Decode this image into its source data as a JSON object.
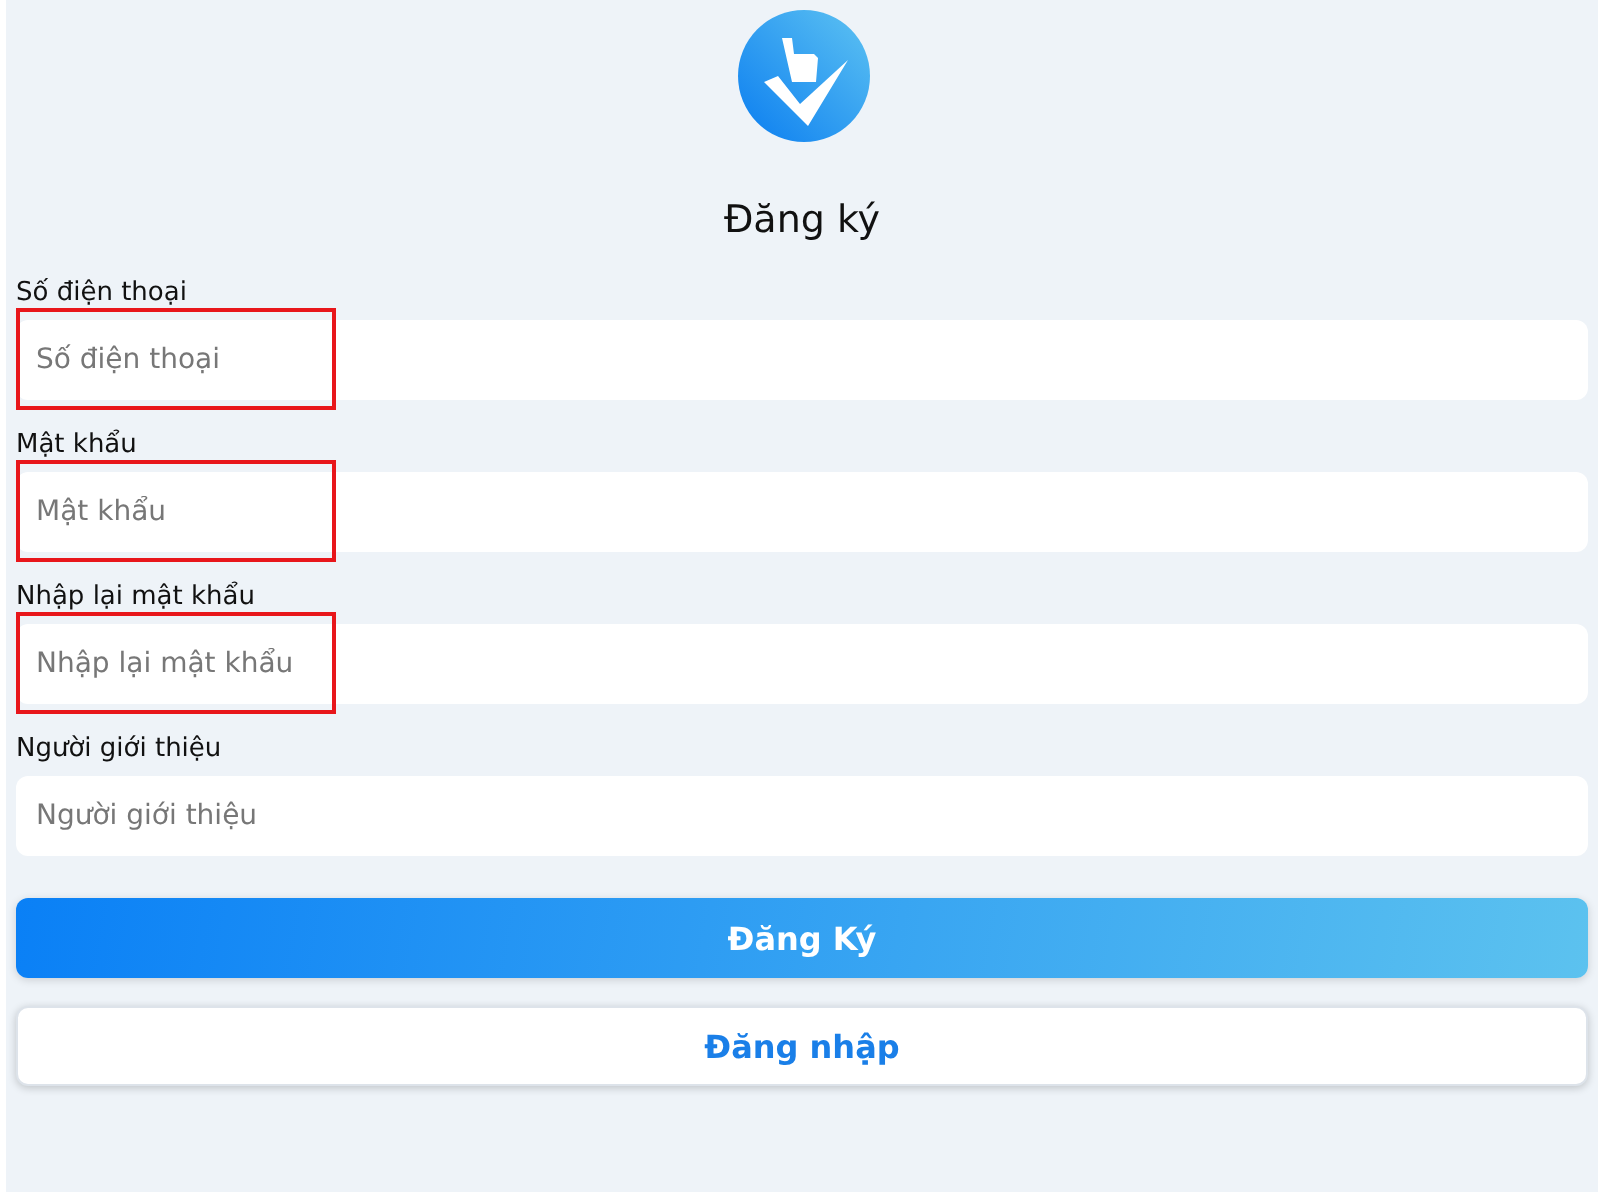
{
  "title": "Đăng ký",
  "fields": [
    {
      "label": "Số điện thoại",
      "placeholder": "Số điện thoại",
      "highlighted": true
    },
    {
      "label": "Mật khẩu",
      "placeholder": "Mật khẩu",
      "highlighted": true
    },
    {
      "label": "Nhập lại mật khẩu",
      "placeholder": "Nhập lại mật khẩu",
      "highlighted": true
    },
    {
      "label": "Người giới thiệu",
      "placeholder": "Người giới thiệu",
      "highlighted": false
    }
  ],
  "buttons": [
    {
      "label": "Đăng Ký",
      "kind": "primary"
    },
    {
      "label": "Đăng nhập",
      "kind": "secondary"
    }
  ]
}
